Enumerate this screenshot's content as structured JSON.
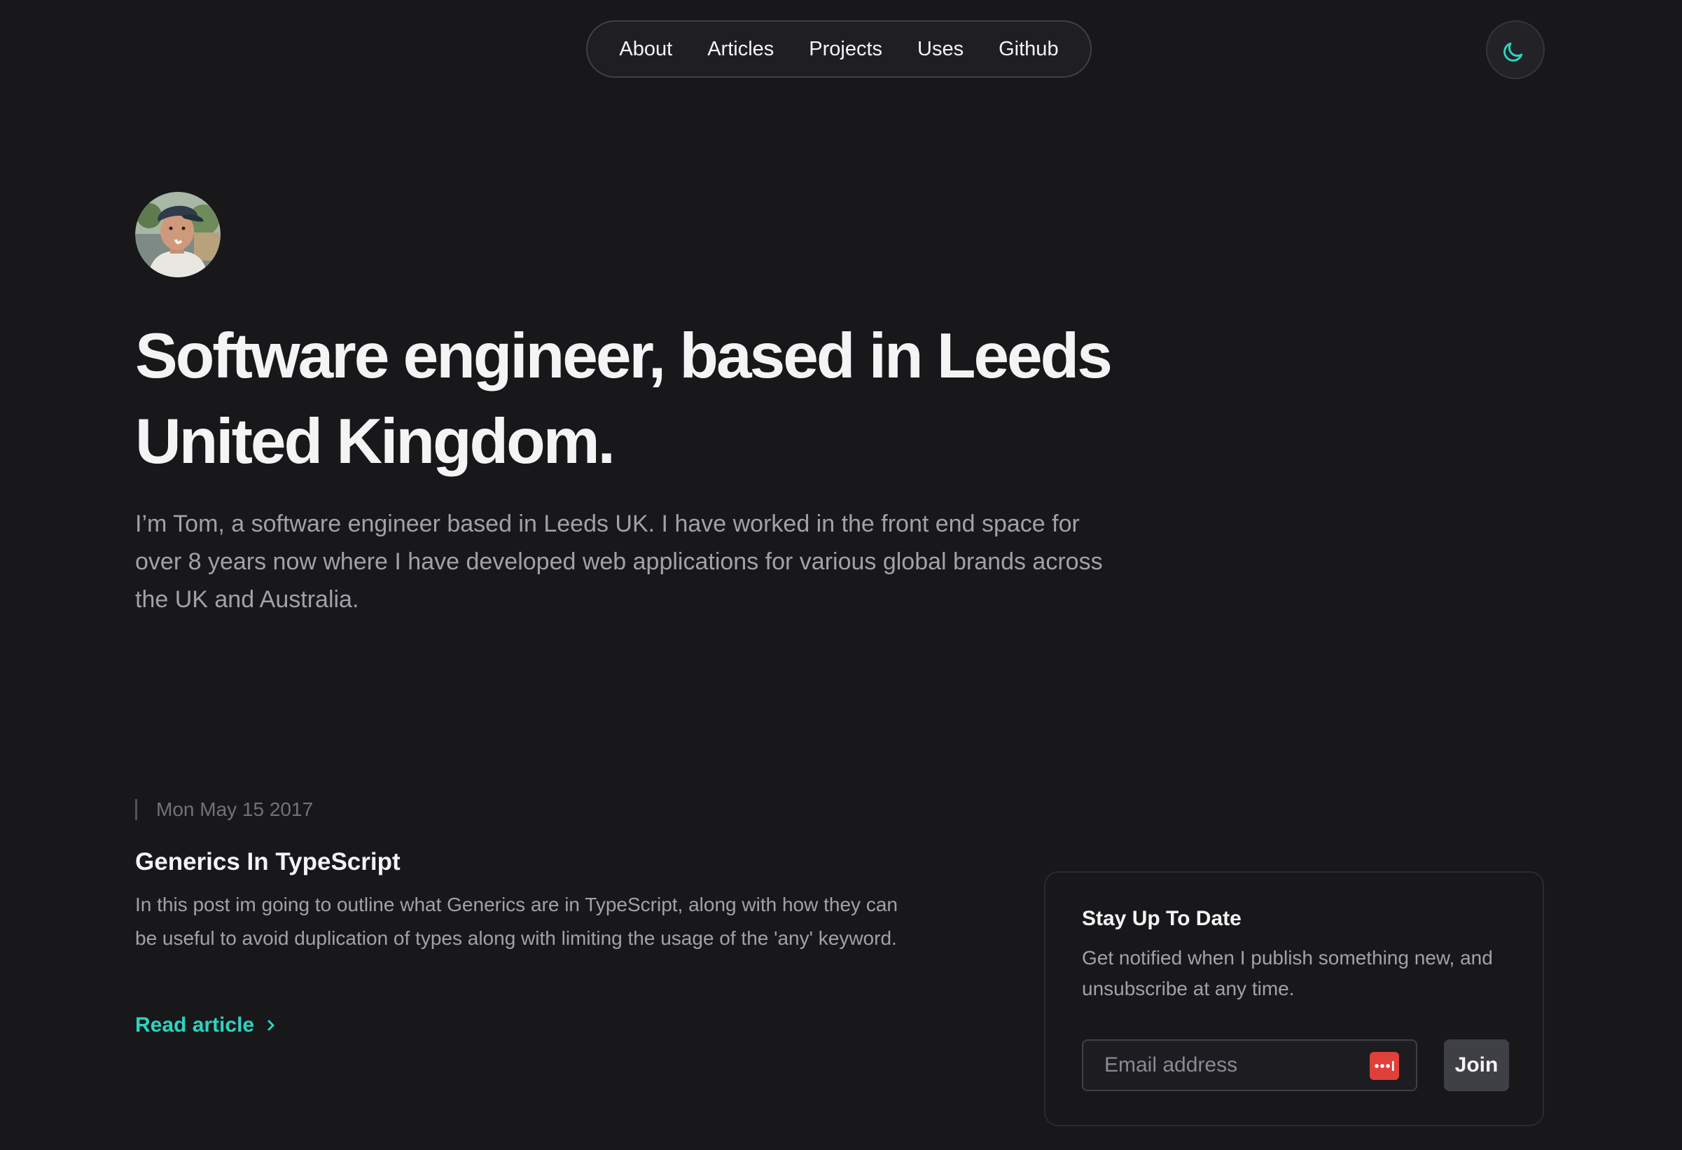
{
  "nav": {
    "items": [
      {
        "label": "About"
      },
      {
        "label": "Articles"
      },
      {
        "label": "Projects"
      },
      {
        "label": "Uses"
      },
      {
        "label": "Github"
      }
    ]
  },
  "theme_toggle": {
    "icon": "moon-icon",
    "color": "#2dd4bf"
  },
  "hero": {
    "avatar_icon": "profile-photo",
    "title_line1": "Software engineer, based in Leeds",
    "title_line2": "United Kingdom.",
    "intro": "I’m Tom, a software engineer based in Leeds UK. I have worked in the front end space for over 8 years now where I have developed web applications for various global brands across the UK and Australia."
  },
  "article": {
    "date": "Mon May 15 2017",
    "title": "Generics In TypeScript",
    "description": "In this post im going to outline what Generics are in TypeScript, along with how they can be useful to avoid duplication of types along with limiting the usage of the 'any' keyword.",
    "cta_label": "Read article",
    "cta_icon": "chevron-right-icon"
  },
  "newsletter": {
    "title": "Stay Up To Date",
    "text": "Get notified when I publish something new, and unsubscribe at any time.",
    "email_placeholder": "Email address",
    "email_value": "",
    "password_manager_icon": "password-manager-icon",
    "join_label": "Join"
  },
  "colors": {
    "background": "#18181b",
    "accent": "#2dd4bf",
    "text_primary": "#f4f4f5",
    "text_secondary": "#a1a1aa",
    "border": "#3f3f46",
    "password_manager": "#e0403a"
  }
}
